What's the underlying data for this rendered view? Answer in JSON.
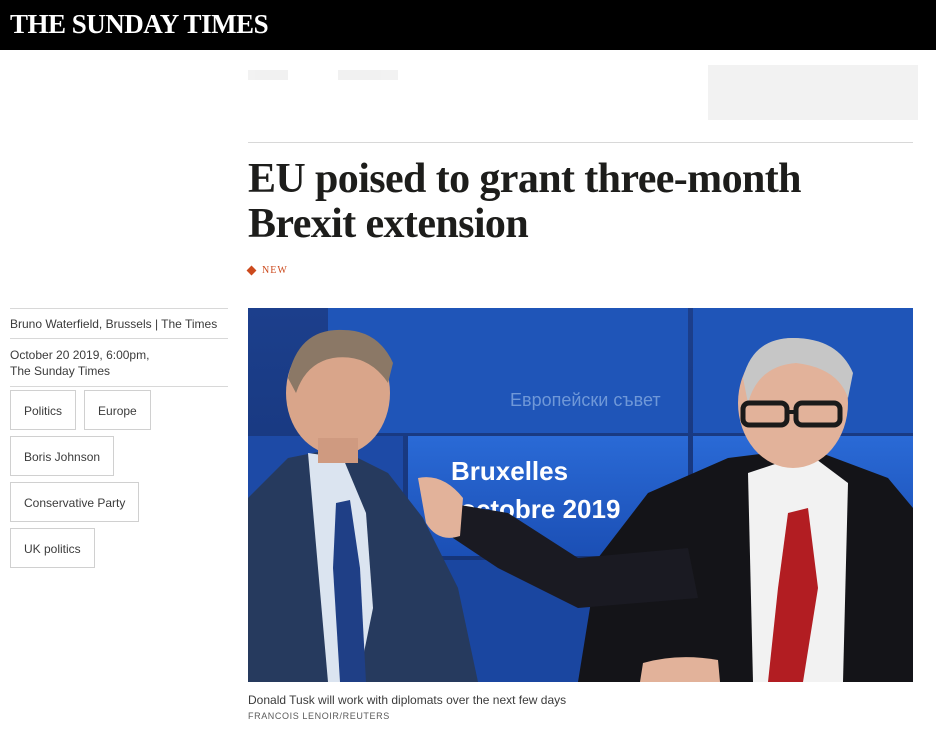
{
  "masthead": {
    "logo": "THE SUNDAY TIMES"
  },
  "article": {
    "headline_line1": "EU poised to grant three-month",
    "headline_line2": "Brexit extension",
    "badge": "NEW",
    "byline": "Bruno Waterfield, Brussels | The Times",
    "date": "October 20 2019, 6:00pm,",
    "publication": "The Sunday Times",
    "tags": [
      "Politics",
      "Europe",
      "Boris Johnson",
      "Conservative Party",
      "UK politics"
    ],
    "image": {
      "screen_text_1": "Европейски съвет",
      "screen_text_2": "Bruxelles",
      "screen_text_3": "octobre 2019"
    },
    "caption": "Donald Tusk will work with diplomats over the next few days",
    "credit": "FRANCOIS LENOIR/REUTERS"
  },
  "colors": {
    "masthead_bg": "#000000",
    "accent": "#cc4a1d",
    "photo_backdrop": "#1f55b8"
  }
}
